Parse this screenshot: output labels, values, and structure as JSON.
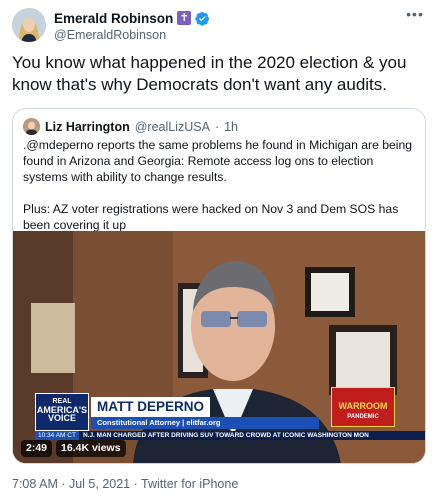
{
  "author": {
    "name": "Emerald Robinson",
    "handle": "@EmeraldRobinson",
    "avatar_icon": "profile-photo",
    "badges": [
      "cross-badge-icon",
      "verified-icon"
    ]
  },
  "tweet": {
    "text": "You know what happened in the 2020 election & you know that's why Democrats don't want any audits."
  },
  "quoted": {
    "name": "Liz Harrington",
    "handle": "@realLizUSA",
    "separator": "·",
    "age": "1h",
    "paragraph1": ".@mdeperno reports the same problems he found in Michigan are being found in Arizona and Georgia: Remote access log ons to election systems with ability to change results.",
    "paragraph2": "Plus: AZ voter registrations were hacked on Nov 3 and Dem SOS has been covering it up"
  },
  "video": {
    "network_logo_line1": "REAL",
    "network_logo_line2": "AMERICA'S",
    "network_logo_line3": "VOICE",
    "person_name": "MATT DEPERNO",
    "person_title": "Constitutional Attorney | elitfar.org",
    "show_logo_line1": "WARROOM",
    "show_logo_line2": "PANDEMIC",
    "ticker_time": "10:34 AM CT",
    "ticker_text": "N.J. MAN CHARGED AFTER DRIVING SUV TOWARD CROWD AT ICONIC WASHINGTON MON",
    "duration": "2:49",
    "views": "16.4K views"
  },
  "footer": {
    "timestamp": "7:08 AM · Jul 5, 2021 · Twitter for iPhone"
  },
  "colors": {
    "text": "#0f1419",
    "secondary": "#536471",
    "verified": "#1d9bf0",
    "border": "#cfd9de"
  }
}
